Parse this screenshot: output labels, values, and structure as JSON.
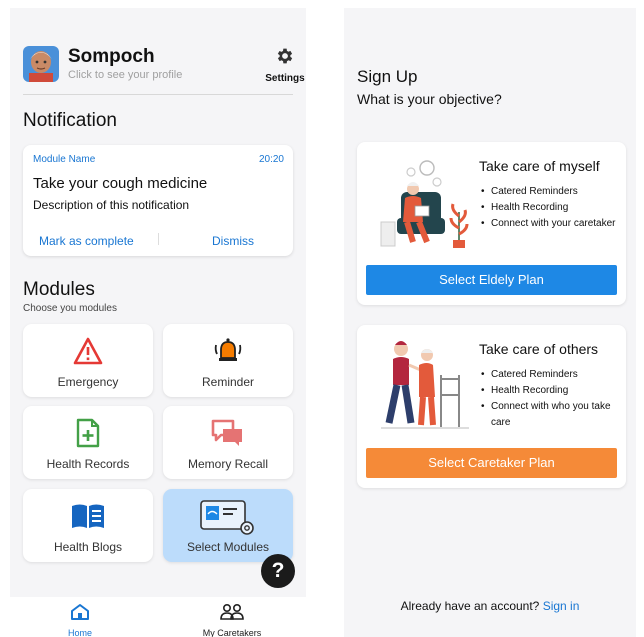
{
  "left": {
    "profile": {
      "name": "Sompoch",
      "subtitle": "Click to see your profile"
    },
    "settings_label": "Settings",
    "notification": {
      "heading": "Notification",
      "module_name": "Module Name",
      "time": "20:20",
      "title": "Take your cough medicine",
      "description": "Description of this notification",
      "mark_complete": "Mark as complete",
      "dismiss": "Dismiss"
    },
    "modules": {
      "heading": "Modules",
      "subtitle": "Choose you modules",
      "items": [
        {
          "label": "Emergency",
          "icon": "warning-triangle-icon",
          "color": "#e53935"
        },
        {
          "label": "Reminder",
          "icon": "alarm-bell-icon",
          "color": "#f57c00"
        },
        {
          "label": "Health Records",
          "icon": "add-document-icon",
          "color": "#43a047"
        },
        {
          "label": "Memory Recall",
          "icon": "chat-bubbles-icon",
          "color": "#e57373"
        },
        {
          "label": "Health Blogs",
          "icon": "open-book-icon",
          "color": "#1565c0"
        },
        {
          "label": "Select Modules",
          "icon": "module-settings-icon",
          "color": "#1e88e5"
        }
      ]
    },
    "help_label": "?",
    "nav": [
      {
        "label": "Home",
        "icon": "home-icon",
        "active": true,
        "color": "#1976d2"
      },
      {
        "label": "My Caretakers",
        "icon": "people-icon",
        "active": false,
        "color": "#222222"
      }
    ]
  },
  "right": {
    "title": "Sign Up",
    "subtitle": "What is your objective?",
    "plans": [
      {
        "title": "Take care of myself",
        "bullets": [
          "Catered Reminders",
          "Health Recording",
          "Connect with your caretaker"
        ],
        "button": "Select Eldely Plan",
        "button_color": "#1e88e5"
      },
      {
        "title": "Take care of others",
        "bullets": [
          "Catered Reminders",
          "Health Recording",
          "Connect with who you take care"
        ],
        "button": "Select Caretaker Plan",
        "button_color": "#f58a38"
      }
    ],
    "signin_prompt": "Already have an account?",
    "signin_link": "Sign in"
  }
}
